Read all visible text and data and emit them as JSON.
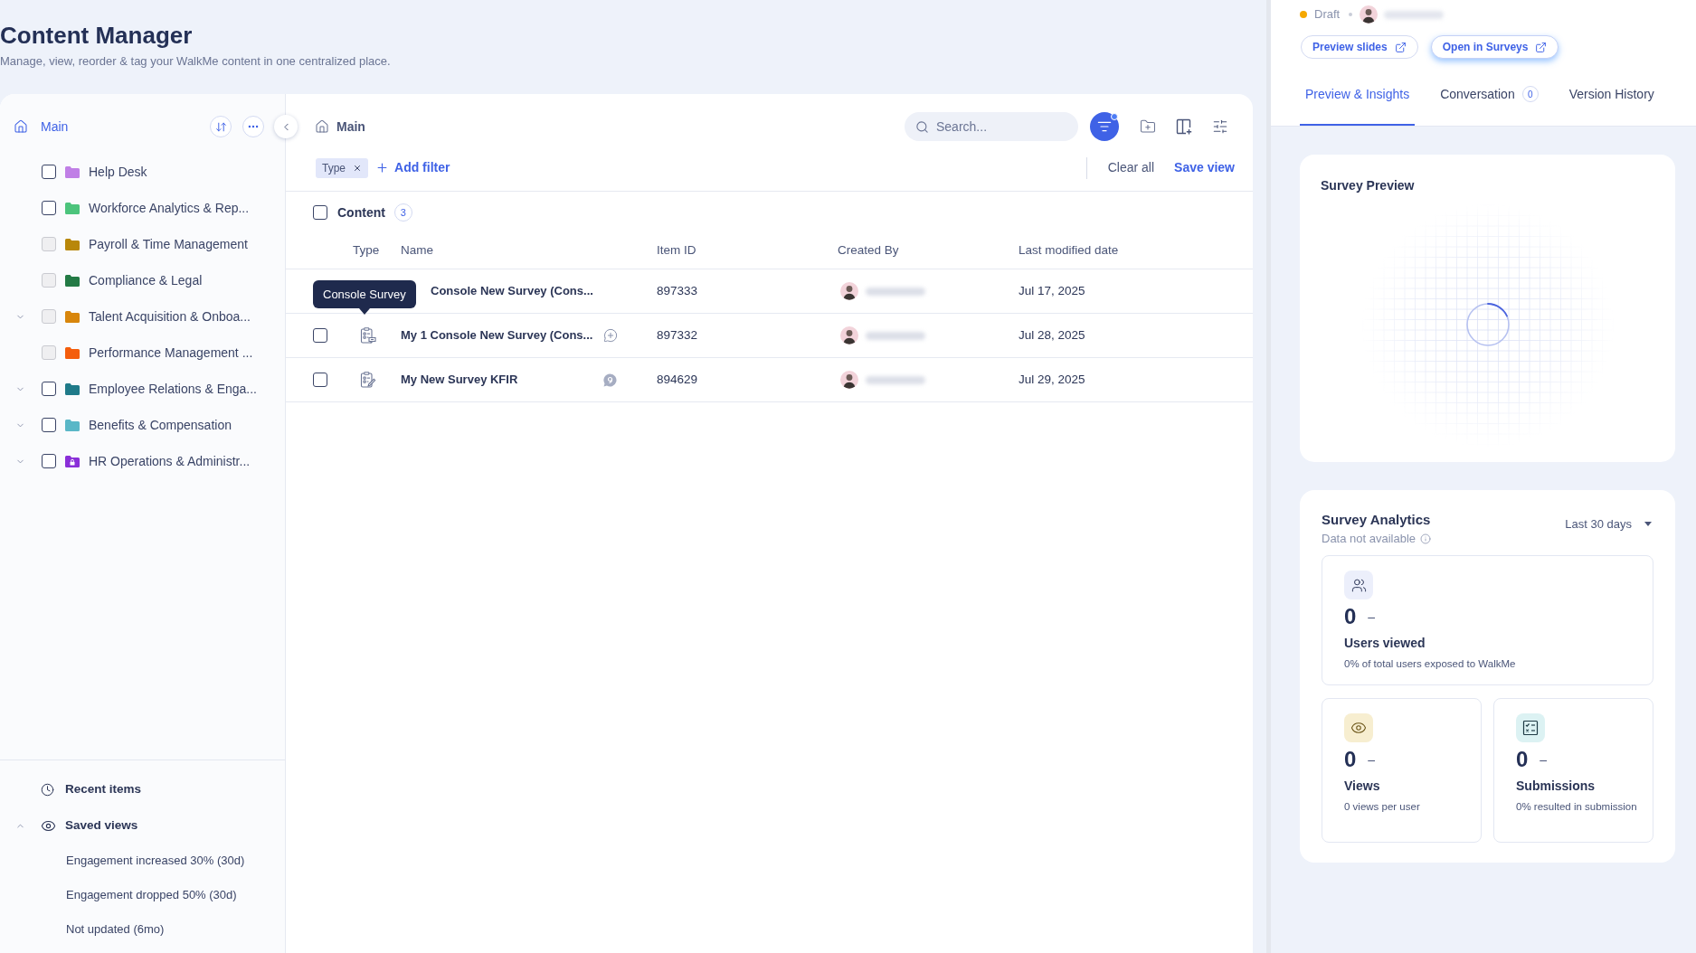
{
  "header": {
    "title": "Content Manager",
    "subtitle": "Manage, view, reorder & tag your WalkMe content in one centralized place."
  },
  "sidebar": {
    "root": {
      "label": "Main",
      "selected": true
    },
    "folders": [
      {
        "label": "Help Desk",
        "color": "#c07fe6",
        "checked": false,
        "disabled": false,
        "expandable": false,
        "locked": false
      },
      {
        "label": "Workforce Analytics & Rep...",
        "color": "#4cc47c",
        "checked": false,
        "disabled": false,
        "expandable": false,
        "locked": false
      },
      {
        "label": "Payroll & Time Management",
        "color": "#b8870a",
        "checked": false,
        "disabled": true,
        "expandable": false,
        "locked": false
      },
      {
        "label": "Compliance & Legal",
        "color": "#237a45",
        "checked": false,
        "disabled": true,
        "expandable": false,
        "locked": false
      },
      {
        "label": "Talent Acquisition & Onboa...",
        "color": "#d8860c",
        "checked": false,
        "disabled": true,
        "expandable": true,
        "locked": false
      },
      {
        "label": "Performance Management ...",
        "color": "#f45d0c",
        "checked": false,
        "disabled": true,
        "expandable": false,
        "locked": false
      },
      {
        "label": "Employee Relations & Enga...",
        "color": "#1f7a89",
        "checked": false,
        "disabled": false,
        "expandable": true,
        "locked": false
      },
      {
        "label": "Benefits & Compensation",
        "color": "#5ab7c7",
        "checked": false,
        "disabled": false,
        "expandable": true,
        "locked": false
      },
      {
        "label": "HR Operations & Administr...",
        "color": "#8a2fd8",
        "checked": false,
        "disabled": false,
        "expandable": true,
        "locked": true
      }
    ],
    "recent": {
      "label": "Recent items"
    },
    "saved_views": {
      "label": "Saved views",
      "expanded": true,
      "items": [
        "Engagement increased 30% (30d)",
        "Engagement dropped 50% (30d)",
        "Not updated (6mo)"
      ]
    }
  },
  "main": {
    "breadcrumb": "Main",
    "search": {
      "placeholder": "Search..."
    },
    "filter_button": {
      "active": true
    },
    "filters": [
      {
        "label": "Type"
      }
    ],
    "add_filter": "Add filter",
    "clear_all": "Clear all",
    "save_view": "Save view",
    "content": {
      "label": "Content",
      "count": "3",
      "checked": false
    },
    "columns": [
      "Type",
      "Name",
      "Item ID",
      "Created By",
      "Last modified date"
    ],
    "rows": [
      {
        "tooltip": "Console Survey",
        "name": "Console New Survey (Cons...",
        "item_id": "897333",
        "date": "Jul 17, 2025"
      },
      {
        "checked": false,
        "kind": "console_survey",
        "name": "My 1 Console New Survey (Cons...",
        "comment": {
          "kind": "add"
        },
        "item_id": "897332",
        "date": "Jul 28, 2025"
      },
      {
        "checked": false,
        "kind": "survey",
        "name": "My New Survey KFIR",
        "comment": {
          "kind": "filled"
        },
        "item_id": "894629",
        "date": "Jul 29, 2025"
      }
    ]
  },
  "detail": {
    "status": {
      "label": "Draft",
      "color": "#f5a800"
    },
    "buttons": [
      {
        "label": "Preview slides",
        "focused": false
      },
      {
        "label": "Open in Surveys",
        "focused": true
      }
    ],
    "tabs": [
      {
        "label": "Preview & Insights",
        "selected": true
      },
      {
        "label": "Conversation",
        "count": "0",
        "selected": false
      },
      {
        "label": "Version History",
        "selected": false
      }
    ],
    "preview": {
      "title": "Survey Preview"
    },
    "analytics": {
      "title": "Survey Analytics",
      "subtitle": "Data not available",
      "range": "Last 30 days",
      "metrics": [
        {
          "kind": "users",
          "value": "0",
          "trend": "–",
          "label": "Users viewed",
          "note": "0% of total users exposed to WalkMe"
        },
        {
          "kind": "views",
          "value": "0",
          "trend": "–",
          "label": "Views",
          "note": "0 views per user"
        },
        {
          "kind": "submissions",
          "value": "0",
          "trend": "–",
          "label": "Submissions",
          "note": "0% resulted in submission"
        }
      ]
    }
  }
}
